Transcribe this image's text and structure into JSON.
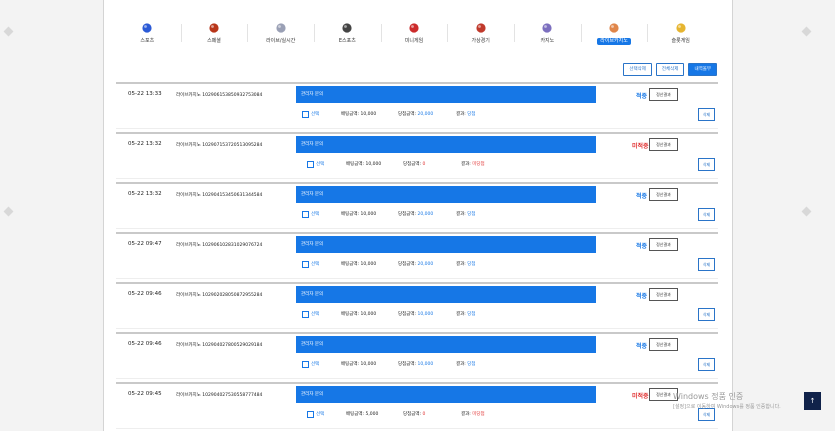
{
  "nav": [
    {
      "label": "스포츠",
      "icon": "soccer-ball-icon",
      "color": "#2b5ad6"
    },
    {
      "label": "스페셜",
      "icon": "basketball-icon",
      "color": "#b8361a"
    },
    {
      "label": "라이브/실시간",
      "icon": "chat-bubbles-icon",
      "color": "#9aa0b5"
    },
    {
      "label": "E스포츠",
      "icon": "gamepad-icon",
      "color": "#444444"
    },
    {
      "label": "미니게임",
      "icon": "car-icon",
      "color": "#cc2b2b"
    },
    {
      "label": "가상경기",
      "icon": "virtual-ball-icon",
      "color": "#c0392b"
    },
    {
      "label": "카지노",
      "icon": "casino-chips-icon",
      "color": "#7c6fbf"
    },
    {
      "label": "라이브카지노",
      "icon": "live-casino-icon",
      "color": "#e0864a",
      "active": true
    },
    {
      "label": "슬롯게임",
      "icon": "slot-icon",
      "color": "#e6b530"
    }
  ],
  "toolbar": {
    "select_all": "선택삭제",
    "delete_all": "전체삭제",
    "history": "내역올부"
  },
  "bets": [
    {
      "date": "05-22 13:33",
      "game": "라이브카지노 102906153850932753084",
      "bar": "관리자 문의",
      "status": "적중",
      "status_type": "hit",
      "result_btn": "정산결과",
      "select": "선택",
      "amount": "배팅금액: 10,000",
      "win_label": "당첨금액:",
      "win_value": "20,000",
      "result_label": "결과:",
      "result_value": "당첨",
      "delete": "삭제"
    },
    {
      "date": "05-22 13:32",
      "game": "라이브카지노 102907153720513095284",
      "bar": "관리자 문의",
      "status": "미적중",
      "status_type": "miss",
      "result_btn": "정산결과",
      "select": "선택",
      "amount": "배팅금액: 10,000",
      "win_label": "당첨금액:",
      "win_value": "0",
      "result_label": "결과:",
      "result_value": "미당첨",
      "delete": "삭제"
    },
    {
      "date": "05-22 13:32",
      "game": "라이브카지노 102904153450631344584",
      "bar": "관리자 문의",
      "status": "적중",
      "status_type": "hit",
      "result_btn": "정산결과",
      "select": "선택",
      "amount": "배팅금액: 10,000",
      "win_label": "당첨금액:",
      "win_value": "20,000",
      "result_label": "결과:",
      "result_value": "당첨",
      "delete": "삭제"
    },
    {
      "date": "05-22 09:47",
      "game": "라이브카지노 102906102831029076724",
      "bar": "관리자 문의",
      "status": "적중",
      "status_type": "hit",
      "result_btn": "정산결과",
      "select": "선택",
      "amount": "배팅금액: 10,000",
      "win_label": "당첨금액:",
      "win_value": "20,000",
      "result_label": "결과:",
      "result_value": "당첨",
      "delete": "삭제"
    },
    {
      "date": "05-22 09:46",
      "game": "라이브카지노 102902028050872955284",
      "bar": "관리자 문의",
      "status": "적중",
      "status_type": "hit",
      "result_btn": "정산결과",
      "select": "선택",
      "amount": "배팅금액: 10,000",
      "win_label": "당첨금액:",
      "win_value": "10,000",
      "result_label": "결과:",
      "result_value": "당첨",
      "delete": "삭제"
    },
    {
      "date": "05-22 09:46",
      "game": "라이브카지노 102904027800529029184",
      "bar": "관리자 문의",
      "status": "적중",
      "status_type": "hit",
      "result_btn": "정산결과",
      "select": "선택",
      "amount": "배팅금액: 10,000",
      "win_label": "당첨금액:",
      "win_value": "10,000",
      "result_label": "결과:",
      "result_value": "당첨",
      "delete": "삭제"
    },
    {
      "date": "05-22 09:45",
      "game": "라이브카지노 102904027530558777484",
      "bar": "관리자 문의",
      "status": "미적중",
      "status_type": "miss",
      "result_btn": "정산결과",
      "select": "선택",
      "amount": "배팅금액: 5,000",
      "win_label": "당첨금액:",
      "win_value": "0",
      "result_label": "결과:",
      "result_value": "미당첨",
      "delete": "삭제"
    }
  ],
  "watermark": {
    "title": "Windows 정품 인증",
    "sub": "[설정]으로 이동하여 Windows를 정품 인증합니다."
  },
  "top_button": "↑"
}
